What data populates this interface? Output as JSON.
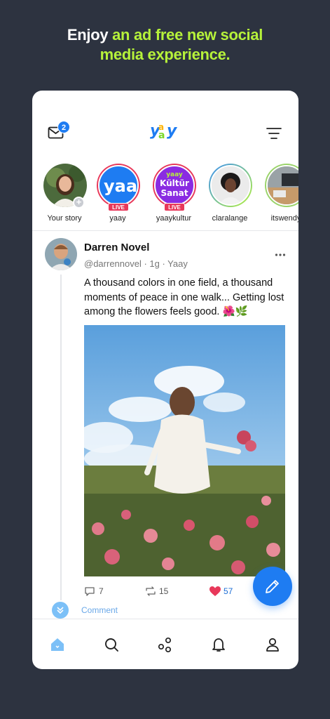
{
  "headline": {
    "line1_white": "Enjoy ",
    "line1_accent": "an ad free new social",
    "line2_accent": "media experience."
  },
  "colors": {
    "accent": "#b6f23a",
    "brand_blue": "#1e7cf2",
    "like_red": "#e8385a",
    "background": "#2d3340"
  },
  "topbar": {
    "mail_badge": "2",
    "logo_text": "yaay",
    "mail_icon": "mail-icon",
    "filter_icon": "filter-icon"
  },
  "stories": [
    {
      "name": "Your story",
      "live": false,
      "add": true
    },
    {
      "name": "yaay",
      "live": true,
      "badge": "LIVE",
      "avatar_text": "yaay"
    },
    {
      "name": "yaaykultur",
      "live": true,
      "badge": "LIVE",
      "avatar_text_top": "yaay",
      "avatar_text_mid": "Kültür",
      "avatar_text_bot": "Sanat"
    },
    {
      "name": "claralange",
      "live": false
    },
    {
      "name": "itswendy",
      "live": false
    }
  ],
  "post": {
    "author": "Darren Novel",
    "meta": "@darrennovel · 1g · Yaay",
    "text": "A thousand colors in one field, a thousand moments of peace in one walk... Getting lost among the flowers feels good. 🌺🌿",
    "comments": "7",
    "reposts": "15",
    "likes": "57",
    "comment_link": "Comment"
  },
  "tabbar": [
    "home-icon",
    "search-icon",
    "discover-icon",
    "notifications-icon",
    "profile-icon"
  ]
}
